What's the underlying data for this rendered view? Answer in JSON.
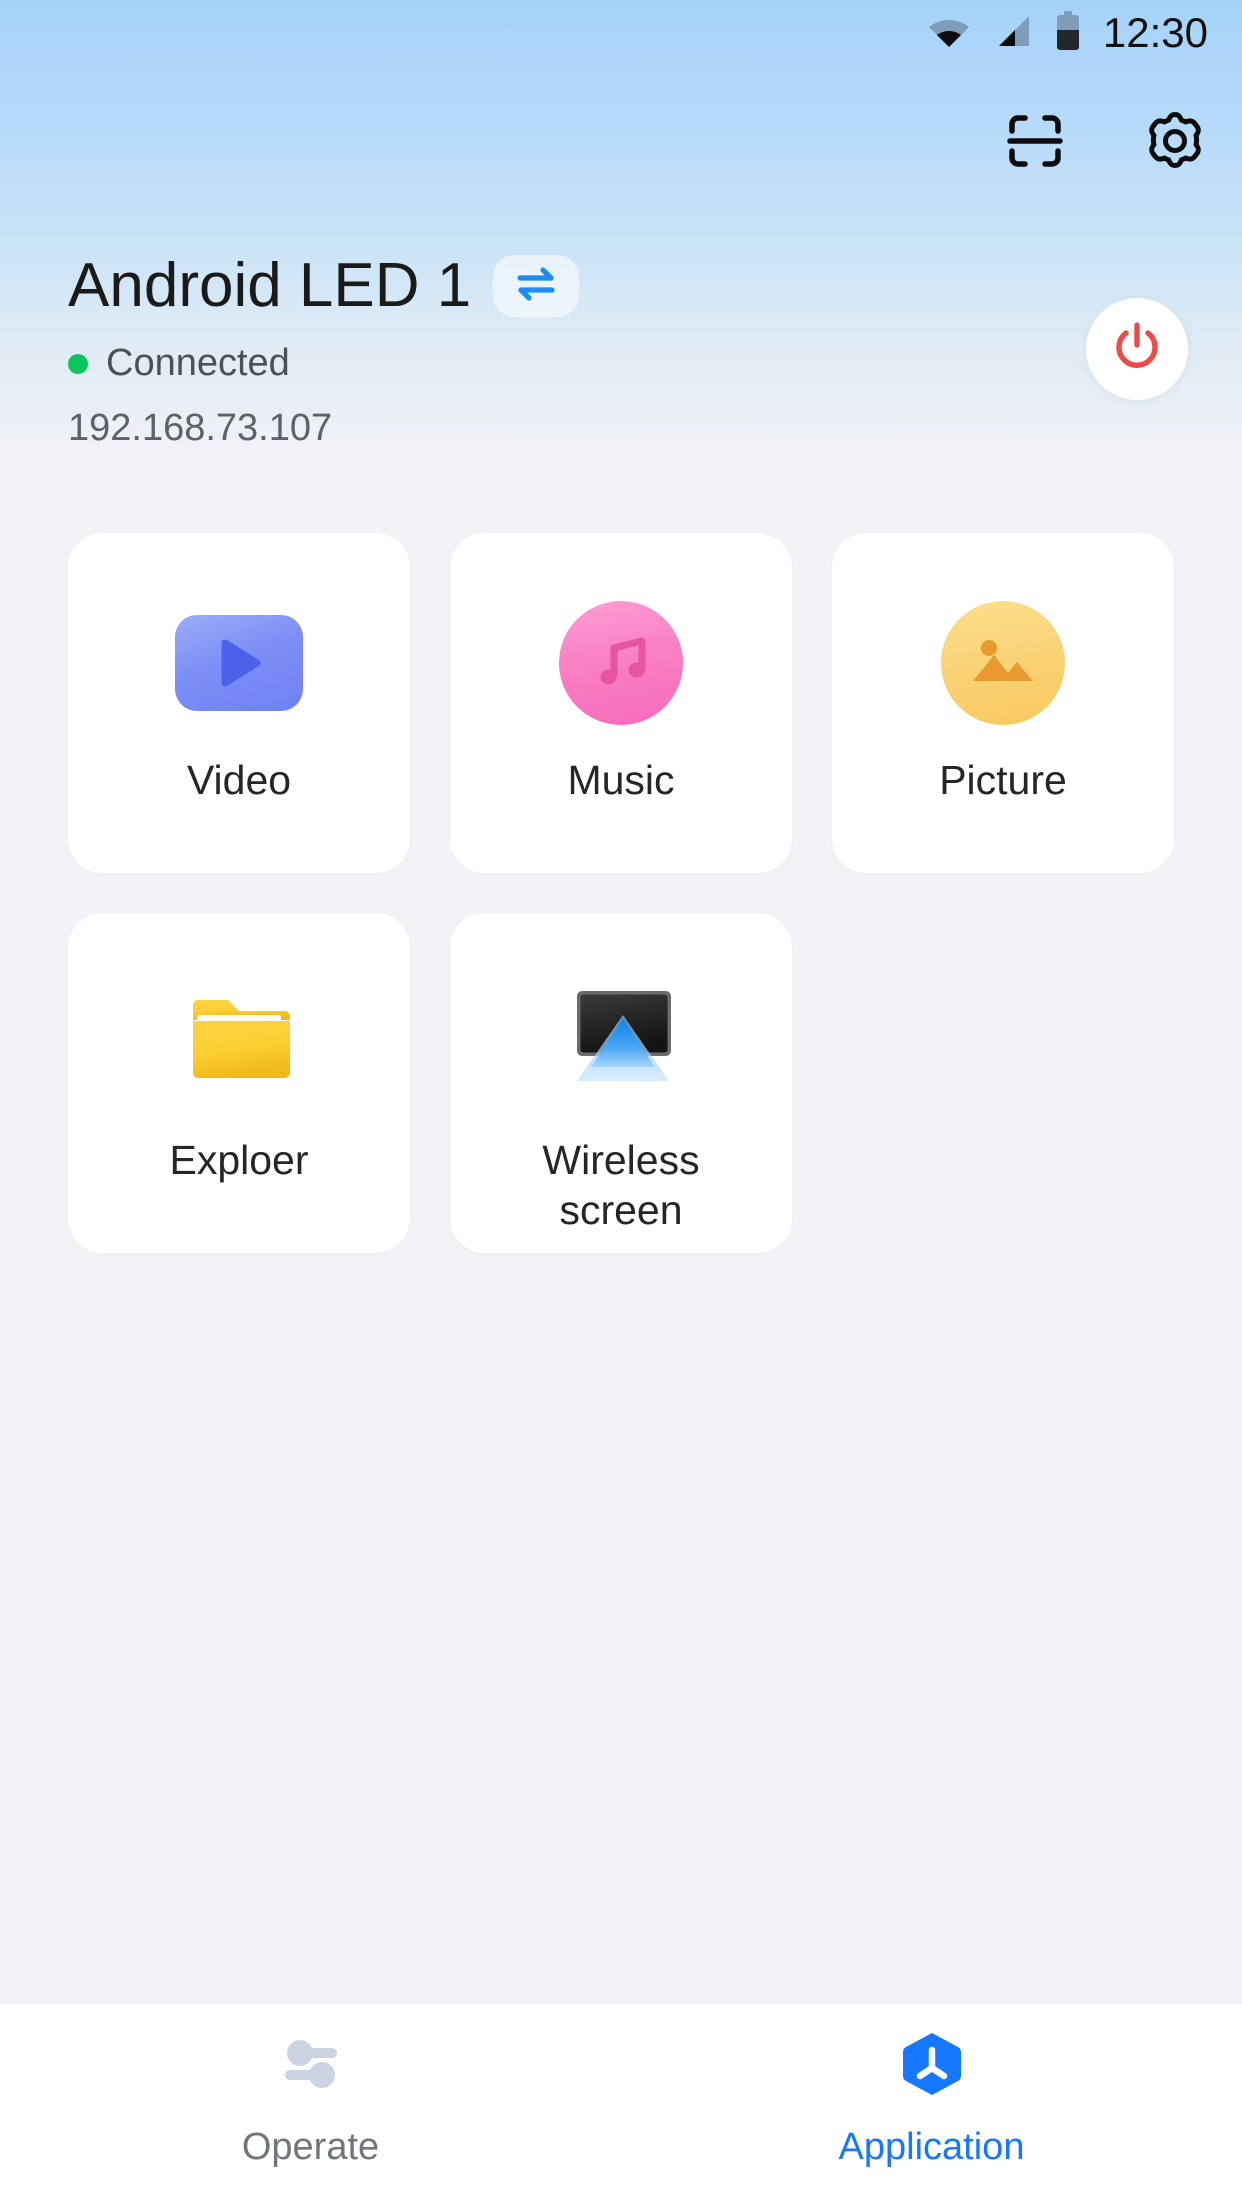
{
  "statusbar": {
    "time": "12:30",
    "wifi_icon": "wifi-icon",
    "signal_icon": "cellular-signal-icon",
    "battery_icon": "battery-icon"
  },
  "header": {
    "scan_icon": "scan-code-icon",
    "settings_icon": "gear-icon"
  },
  "device": {
    "name": "Android LED 1",
    "swap_icon": "switch-device-icon",
    "status": "Connected",
    "status_color": "#0ac65f",
    "ip": "192.168.73.107",
    "power_icon": "power-icon",
    "power_color": "#f04a48"
  },
  "apps": [
    {
      "label": "Video",
      "icon": "video-play-icon",
      "color": "#7c8ff6"
    },
    {
      "label": "Music",
      "icon": "music-note-icon",
      "color": "#f97ec2"
    },
    {
      "label": "Picture",
      "icon": "image-picture-icon",
      "color": "#fad173"
    },
    {
      "label": "Exploer",
      "icon": "folder-icon",
      "color": "#f5c33b"
    },
    {
      "label": "Wireless\nscreen",
      "icon": "cast-screen-icon",
      "color": "#1f88f5"
    }
  ],
  "app_labels": {
    "video": "Video",
    "music": "Music",
    "picture": "Picture",
    "explorer": "Exploer",
    "wireless_line1": "Wireless",
    "wireless_line2": "screen"
  },
  "bottom_nav": {
    "items": [
      {
        "label": "Operate",
        "icon": "sliders-icon",
        "active": false
      },
      {
        "label": "Application",
        "icon": "application-icon",
        "active": true
      }
    ],
    "operate_label": "Operate",
    "application_label": "Application",
    "active_color": "#1677ff",
    "inactive_color": "#71757c"
  }
}
